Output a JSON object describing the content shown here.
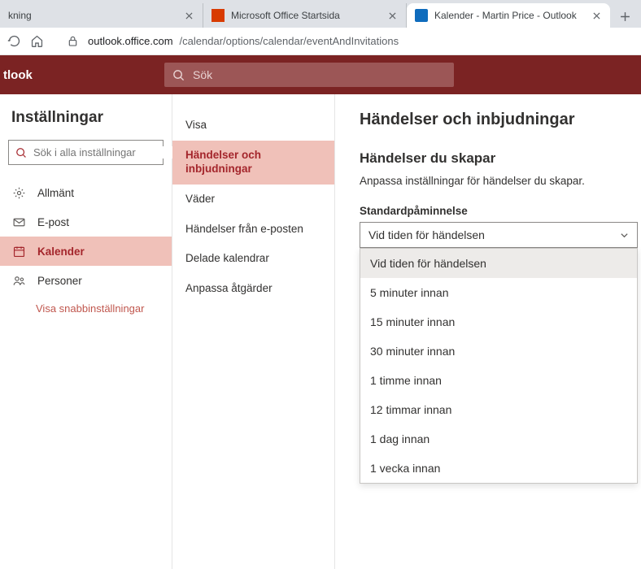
{
  "tabs": [
    {
      "title": "kning",
      "favicon": ""
    },
    {
      "title": "Microsoft Office Startsida",
      "favicon": "office"
    },
    {
      "title": "Kalender - Martin Price - Outlook",
      "favicon": "outlook",
      "active": true
    }
  ],
  "url": {
    "host": "outlook.office.com",
    "path": "/calendar/options/calendar/eventAndInvitations"
  },
  "brand": "tlook",
  "search_placeholder": "Sök",
  "left": {
    "title": "Inställningar",
    "search_placeholder": "Sök i alla inställningar",
    "items": [
      {
        "icon": "gear",
        "label": "Allmänt"
      },
      {
        "icon": "mail",
        "label": "E-post"
      },
      {
        "icon": "calendar",
        "label": "Kalender",
        "selected": true
      },
      {
        "icon": "people",
        "label": "Personer"
      }
    ],
    "quick": "Visa snabbinställningar"
  },
  "mid": {
    "items": [
      {
        "label": "Visa"
      },
      {
        "label": "Händelser och inbjudningar",
        "selected": true
      },
      {
        "label": "Väder"
      },
      {
        "label": "Händelser från e-posten"
      },
      {
        "label": "Delade kalendrar"
      },
      {
        "label": "Anpassa åtgärder"
      }
    ]
  },
  "right": {
    "title": "Händelser och inbjudningar",
    "section_title": "Händelser du skapar",
    "description": "Anpassa inställningar för händelser du skapar.",
    "field_label": "Standardpåminnelse",
    "selected_value": "Vid tiden för händelsen",
    "options": [
      "Vid tiden för händelsen",
      "5 minuter innan",
      "15 minuter innan",
      "30 minuter innan",
      "1 timme innan",
      "12 timmar innan",
      "1 dag innan",
      "1 vecka innan"
    ]
  }
}
